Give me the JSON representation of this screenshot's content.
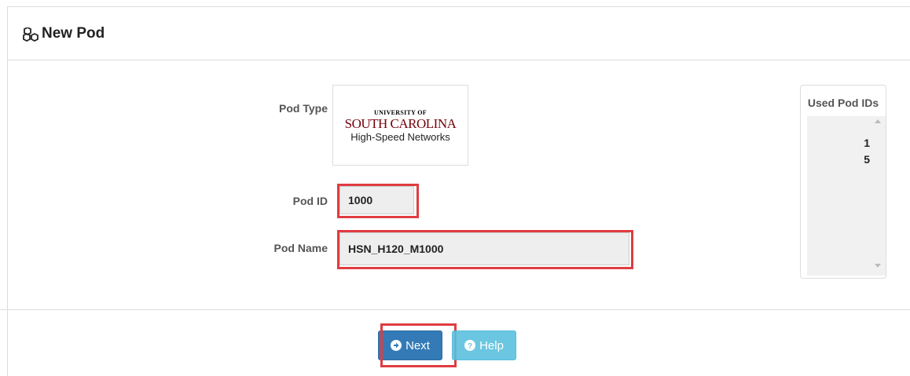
{
  "header": {
    "title": "New Pod",
    "icon": "cubes-icon"
  },
  "form": {
    "pod_type_label": "Pod Type",
    "pod_type_logo": {
      "line1": "UNIVERSITY OF",
      "line2": "SOUTH CAROLINA",
      "line3": "High-Speed Networks",
      "brand_color": "#73000a"
    },
    "pod_id_label": "Pod ID",
    "pod_id_value": "1000",
    "pod_name_label": "Pod Name",
    "pod_name_value": "HSN_H120_M1000"
  },
  "used_ids": {
    "title": "Used Pod IDs",
    "items": [
      "1",
      "5"
    ]
  },
  "actions": {
    "next_label": "Next",
    "help_label": "Help"
  },
  "colors": {
    "highlight": "#e03c41",
    "primary": "#337ab7",
    "info": "#5bc0de"
  }
}
